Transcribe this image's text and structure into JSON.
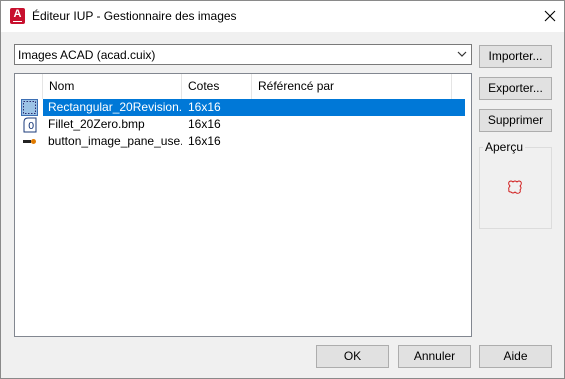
{
  "window": {
    "title": "Éditeur IUP - Gestionnaire des images",
    "app_icon_letter": "A"
  },
  "source_select": {
    "value": "Images ACAD (acad.cuix)"
  },
  "list": {
    "columns": [
      "Nom",
      "Cotes",
      "Référencé par"
    ],
    "rows": [
      {
        "name": "Rectangular_20Revision...",
        "cotes": "16x16",
        "ref": "",
        "icon": "rectangular-revision-icon",
        "selected": true
      },
      {
        "name": "Fillet_20Zero.bmp",
        "cotes": "16x16",
        "ref": "",
        "icon": "fillet-zero-icon",
        "selected": false
      },
      {
        "name": "button_image_pane_use...",
        "cotes": "16x16",
        "ref": "",
        "icon": "button-image-pane-icon",
        "selected": false
      }
    ]
  },
  "buttons": {
    "import": "Importer...",
    "export": "Exporter...",
    "delete": "Supprimer",
    "ok": "OK",
    "cancel": "Annuler",
    "help": "Aide"
  },
  "preview": {
    "label": "Aperçu",
    "icon": "revision-cloud-preview-icon"
  },
  "colors": {
    "selection": "#0078d7",
    "brand": "#c8102e",
    "dialog_bg": "#f0f0f0"
  }
}
